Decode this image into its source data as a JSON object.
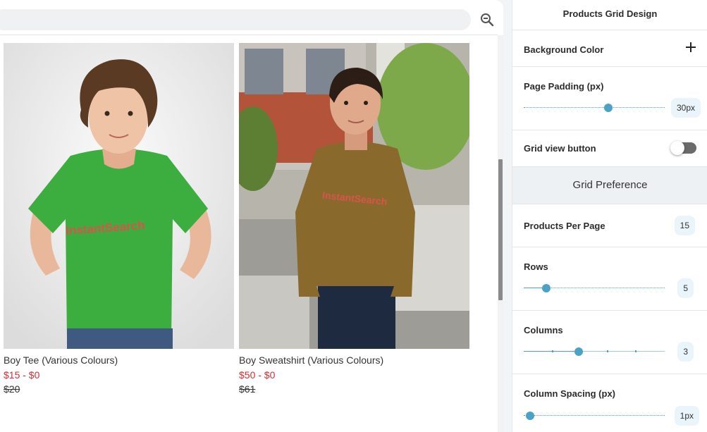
{
  "search": {
    "placeholder": "",
    "icon": "zoom-out-icon"
  },
  "products": [
    {
      "title": "Boy Tee (Various Colours)",
      "price": "$15 - $0",
      "compare_price": "$20",
      "shirt_color": "#3cae3f",
      "logo_text": "InstantSearch"
    },
    {
      "title": "Boy Sweatshirt (Various Colours)",
      "price": "$50 - $0",
      "compare_price": "$61",
      "shirt_color": "#8a6a2c",
      "logo_text": "InstantSearch"
    }
  ],
  "panel": {
    "title": "Products Grid Design",
    "background_color": {
      "label": "Background Color",
      "icon": "plus-icon"
    },
    "page_padding": {
      "label": "Page Padding (px)",
      "value": "30px",
      "level": 0.6
    },
    "grid_view_button": {
      "label": "Grid view button",
      "enabled": false
    },
    "grid_preference": {
      "title": "Grid Preference"
    },
    "products_per_page": {
      "label": "Products Per Page",
      "value": "15"
    },
    "rows": {
      "label": "Rows",
      "value": "5",
      "level": 0.16
    },
    "columns": {
      "label": "Columns",
      "value": "3",
      "level": 0.39
    },
    "column_spacing": {
      "label": "Column Spacing (px)",
      "value": "1px",
      "level": 0.04
    }
  },
  "colors": {
    "accent": "#4aa3c5",
    "price": "#d32f2f",
    "badge_bg": "#eaf4fb"
  }
}
